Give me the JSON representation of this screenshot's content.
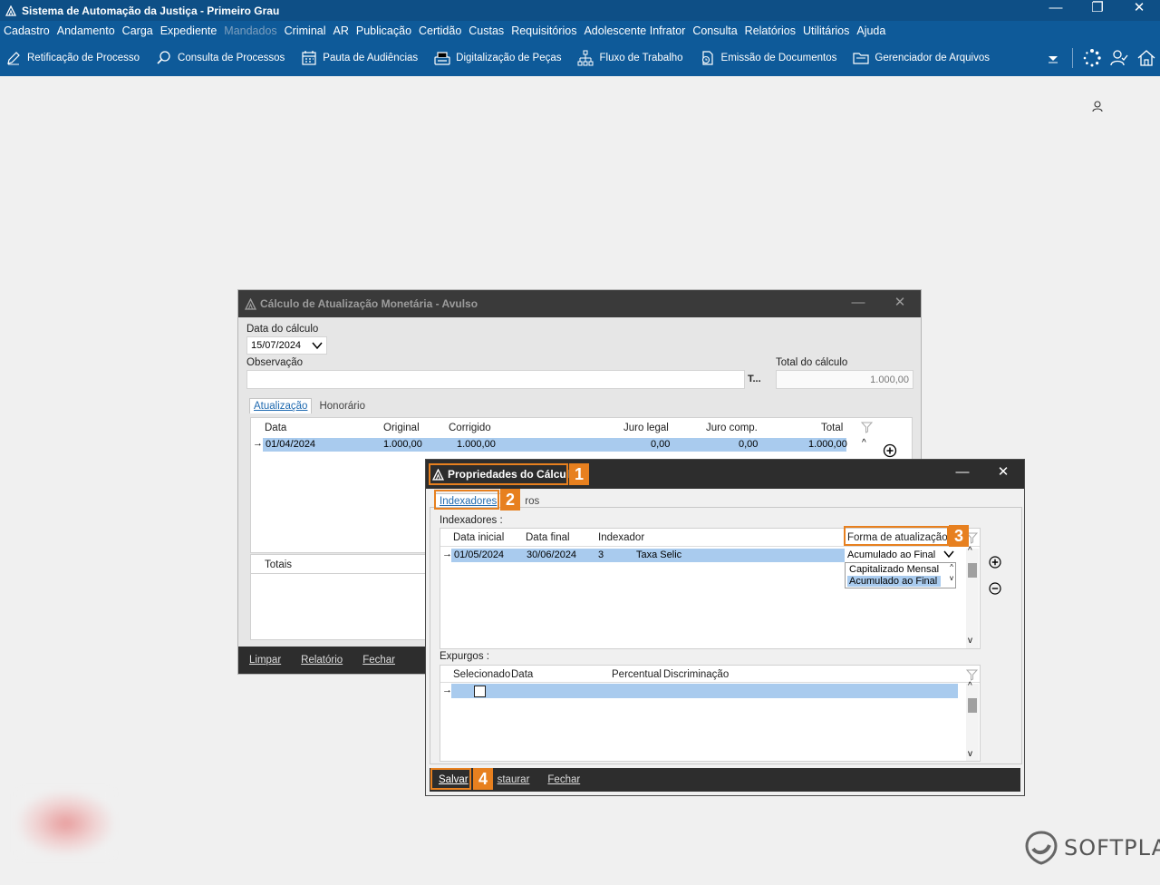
{
  "app": {
    "title": "Sistema de Automação da Justiça - Primeiro Grau",
    "window_controls": [
      "—",
      "❐",
      "✕"
    ]
  },
  "menu": [
    {
      "label": "Cadastro",
      "disabled": false
    },
    {
      "label": "Andamento",
      "disabled": false
    },
    {
      "label": "Carga",
      "disabled": false
    },
    {
      "label": "Expediente",
      "disabled": false
    },
    {
      "label": "Mandados",
      "disabled": true
    },
    {
      "label": "Criminal",
      "disabled": false
    },
    {
      "label": "AR",
      "disabled": false
    },
    {
      "label": "Publicação",
      "disabled": false
    },
    {
      "label": "Certidão",
      "disabled": false
    },
    {
      "label": "Custas",
      "disabled": false
    },
    {
      "label": "Requisitórios",
      "disabled": false
    },
    {
      "label": "Adolescente Infrator",
      "disabled": false
    },
    {
      "label": "Consulta",
      "disabled": false
    },
    {
      "label": "Relatórios",
      "disabled": false
    },
    {
      "label": "Utilitários",
      "disabled": false
    },
    {
      "label": "Ajuda",
      "disabled": false
    }
  ],
  "toolbar": [
    {
      "label": "Retificação de Processo",
      "icon": "edit-icon"
    },
    {
      "label": "Consulta de Processos",
      "icon": "search-icon"
    },
    {
      "label": "Pauta de Audiências",
      "icon": "calendar-icon"
    },
    {
      "label": "Digitalização de Peças",
      "icon": "scanner-icon"
    },
    {
      "label": "Fluxo de Trabalho",
      "icon": "workflow-icon"
    },
    {
      "label": "Emissão de Documentos",
      "icon": "document-icon"
    },
    {
      "label": "Gerenciador de Arquivos",
      "icon": "folder-icon"
    }
  ],
  "calc_dialog": {
    "title": "Cálculo de Atualização Monetária - Avulso",
    "data_calculo_label": "Data do cálculo",
    "data_calculo_value": "15/07/2024",
    "observacao_label": "Observação",
    "observacao_value": "",
    "text_btn": "T...",
    "total_label": "Total do cálculo",
    "total_value": "1.000,00",
    "tabs": [
      "Atualização",
      "Honorário"
    ],
    "columns": [
      "Data",
      "Original",
      "Corrigido",
      "Juro legal",
      "Juro comp.",
      "Total"
    ],
    "rows": [
      {
        "data": "01/04/2024",
        "original": "1.000,00",
        "corrigido": "1.000,00",
        "juro_legal": "0,00",
        "juro_comp": "0,00",
        "total": "1.000,00"
      }
    ],
    "totais_label": "Totais",
    "footer": [
      "Limpar",
      "Relatório",
      "Fechar"
    ]
  },
  "props_dialog": {
    "title": "Propriedades do Cálculo",
    "tab_active": "Indexadores",
    "tab_other_visible": "ros",
    "indexadores_label": "Indexadores :",
    "columns": [
      "Data inicial",
      "Data final",
      "Indexador",
      "Forma de atualização"
    ],
    "rows": [
      {
        "data_inicial": "01/05/2024",
        "data_final": "30/06/2024",
        "indexador_id": "3",
        "indexador_nome": "Taxa Selic",
        "forma": "Acumulado ao Final"
      }
    ],
    "forma_options": [
      "Capitalizado Mensal",
      "Acumulado ao Final"
    ],
    "forma_selected": "Acumulado ao Final",
    "expurgos_label": "Expurgos :",
    "expurgos_columns": [
      "Selecionado",
      "Data",
      "Percentual",
      "Discriminação"
    ],
    "footer": [
      "Salvar",
      "staurar",
      "Fechar"
    ]
  },
  "callouts": [
    "1",
    "2",
    "3",
    "4"
  ],
  "brand": "SOFTPLAN",
  "colors": {
    "title_bar": "#0e4f86",
    "menu_bar": "#0e5a99",
    "selection": "#a9cbee",
    "callout": "#e7801f",
    "dialog_header": "#2d2d2d"
  }
}
